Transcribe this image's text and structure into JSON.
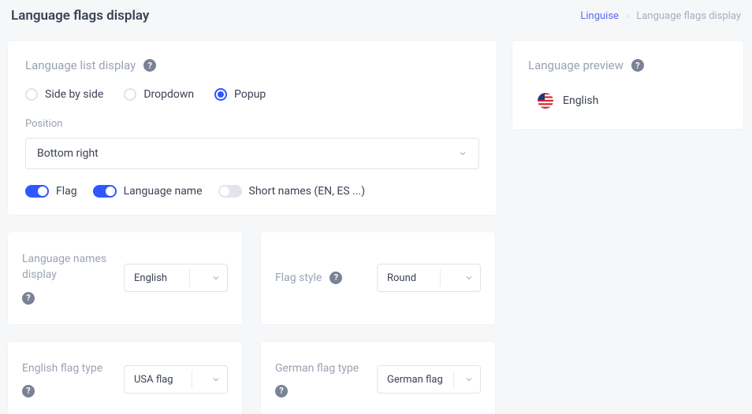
{
  "header": {
    "page_title": "Language flags display",
    "breadcrumb_root": "Linguise",
    "breadcrumb_current": "Language flags display"
  },
  "list_display": {
    "section_label": "Language list display",
    "options": {
      "side_by_side": "Side by side",
      "dropdown": "Dropdown",
      "popup": "Popup"
    },
    "position_label": "Position",
    "position_value": "Bottom right",
    "toggles": {
      "flag_label": "Flag",
      "language_name_label": "Language name",
      "short_names_label": "Short names (EN, ES ...)"
    }
  },
  "preview": {
    "section_label": "Language preview",
    "item_label": "English"
  },
  "language_names_display": {
    "label": "Language names display",
    "value": "English"
  },
  "flag_style": {
    "label": "Flag style",
    "value": "Round"
  },
  "english_flag_type": {
    "label": "English flag type",
    "value": "USA flag"
  },
  "german_flag_type": {
    "label": "German flag type",
    "value": "German flag"
  }
}
